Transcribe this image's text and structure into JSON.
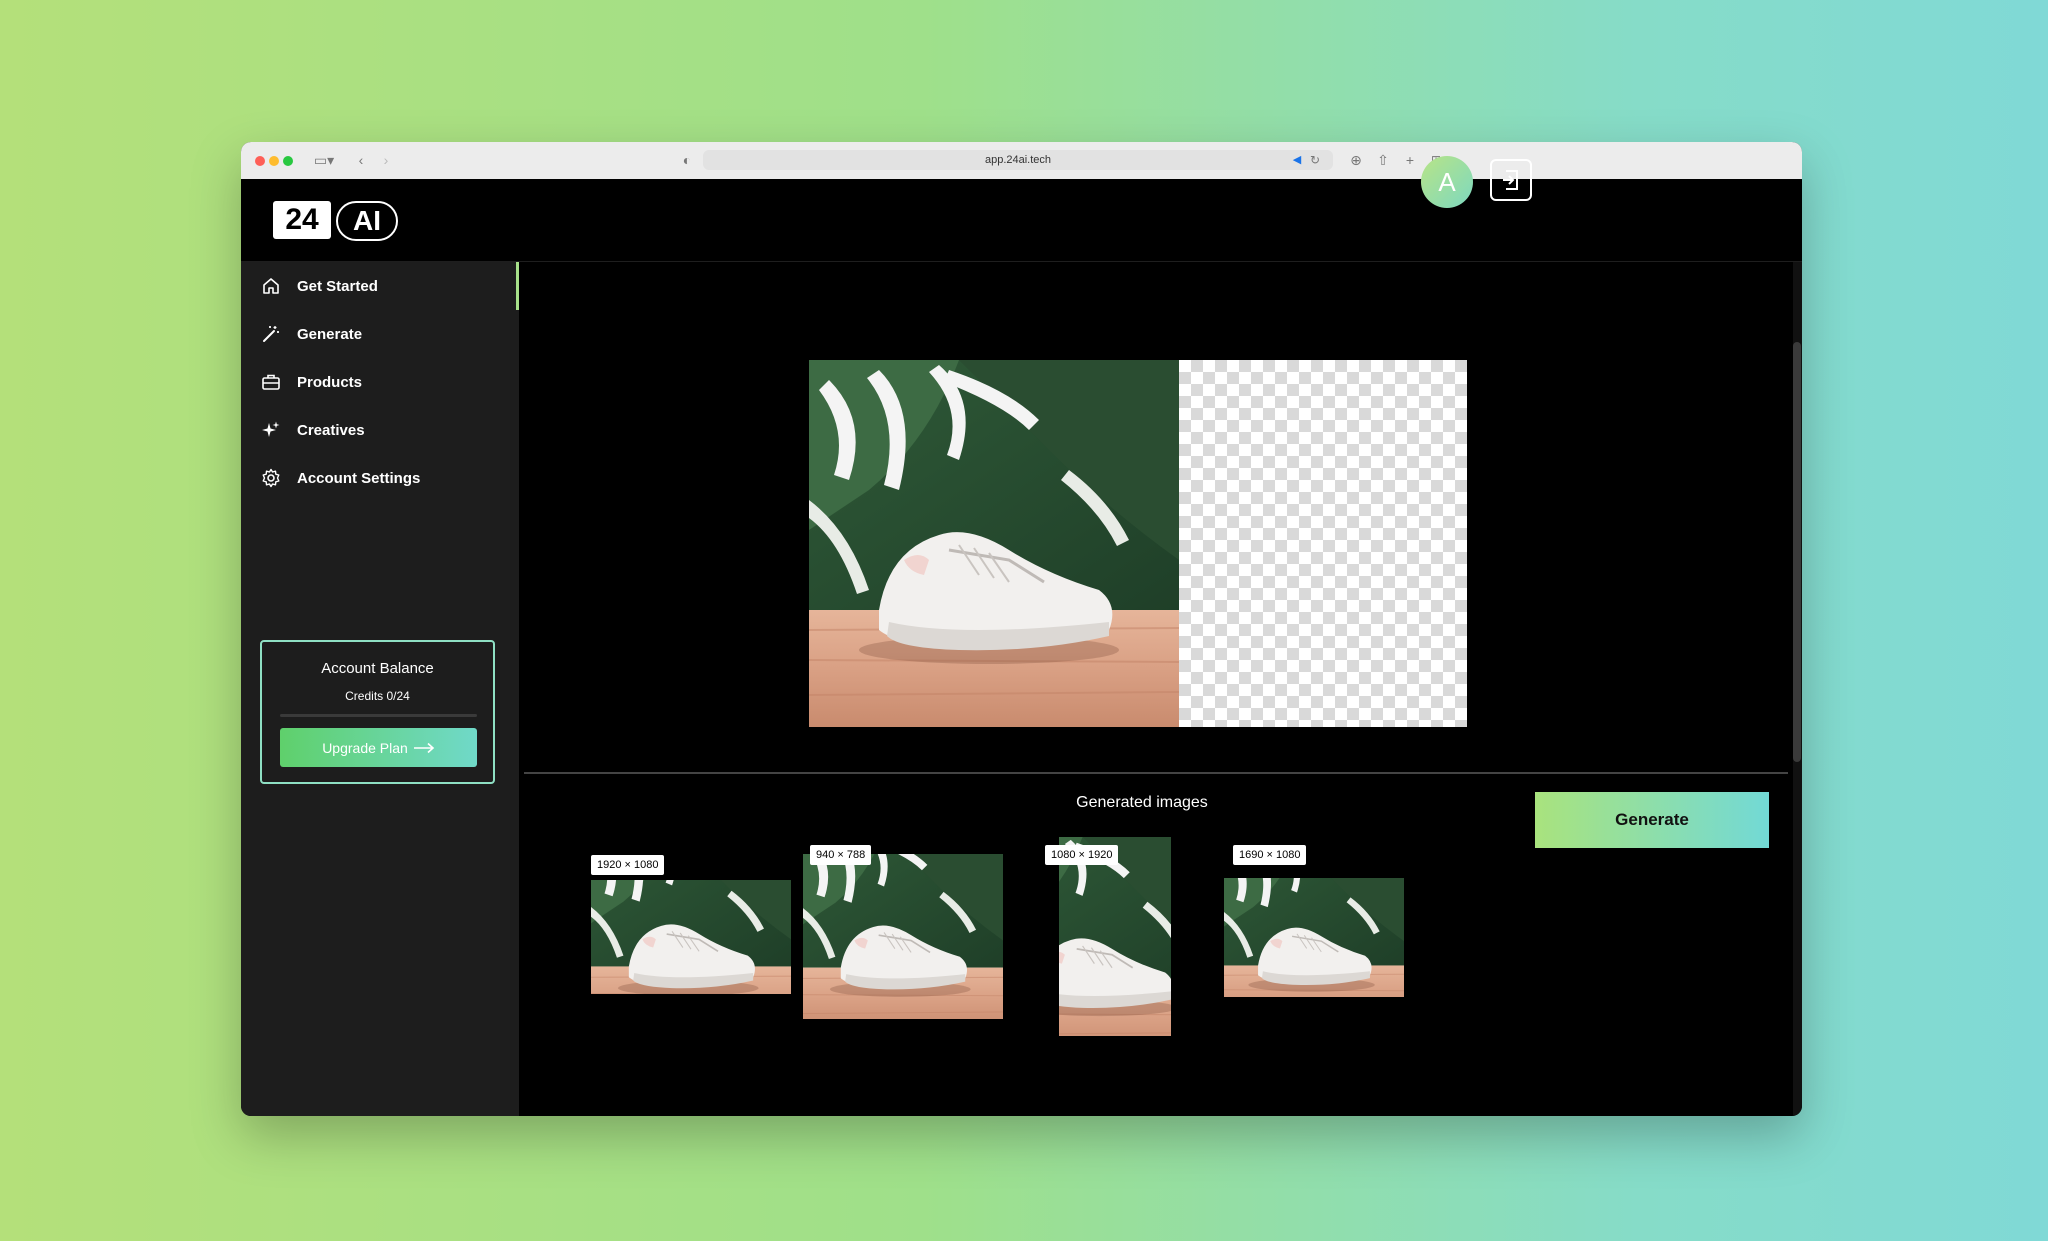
{
  "browser": {
    "url": "app.24ai.tech"
  },
  "header": {
    "logo_left": "24",
    "logo_right": "AI",
    "avatar_initial": "A"
  },
  "sidebar": {
    "items": [
      {
        "label": "Get Started",
        "icon": "home-icon"
      },
      {
        "label": "Generate",
        "icon": "magic-wand-icon"
      },
      {
        "label": "Products",
        "icon": "toolbox-icon"
      },
      {
        "label": "Creatives",
        "icon": "sparkles-icon"
      },
      {
        "label": "Account Settings",
        "icon": "gear-icon"
      }
    ],
    "active_index": 0
  },
  "balance": {
    "title": "Account Balance",
    "credits": "Credits 0/24",
    "used_fraction": 0,
    "upgrade_label": "Upgrade Plan"
  },
  "main": {
    "generated_title": "Generated images",
    "generate_label": "Generate",
    "thumbnails": [
      {
        "size": "1920 × 1080"
      },
      {
        "size": "940 × 788"
      },
      {
        "size": "1080 × 1920"
      },
      {
        "size": "1690 × 1080"
      }
    ]
  },
  "colors": {
    "accent_green": "#a9e37d",
    "accent_teal": "#72d9d6",
    "sidebar_bg": "#1d1d1d"
  }
}
